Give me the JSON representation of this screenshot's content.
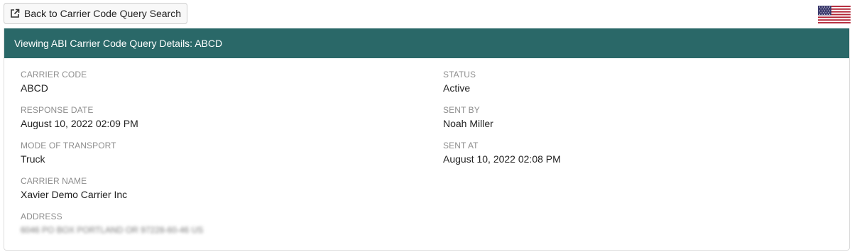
{
  "toolbar": {
    "back_label": "Back to Carrier Code Query Search",
    "back_icon": "external-link-icon"
  },
  "flag": {
    "icon": "us-flag-icon",
    "colors": {
      "red": "#b22234",
      "white": "#ffffff",
      "blue": "#3c3b6e"
    }
  },
  "panel": {
    "title": "Viewing ABI Carrier Code Query Details: ABCD",
    "header_color": "#2a6868"
  },
  "fields_left": [
    {
      "label": "CARRIER CODE",
      "value": "ABCD"
    },
    {
      "label": "RESPONSE DATE",
      "value": "August 10, 2022 02:09 PM"
    },
    {
      "label": "MODE OF TRANSPORT",
      "value": "Truck"
    },
    {
      "label": "CARRIER NAME",
      "value": "Xavier Demo Carrier Inc"
    },
    {
      "label": "ADDRESS",
      "value": "6046 PO BOX PORTLAND OR 97228-60-46 US"
    }
  ],
  "fields_right": [
    {
      "label": "STATUS",
      "value": "Active"
    },
    {
      "label": "SENT BY",
      "value": "Noah Miller"
    },
    {
      "label": "SENT AT",
      "value": "August 10, 2022 02:08 PM"
    }
  ]
}
